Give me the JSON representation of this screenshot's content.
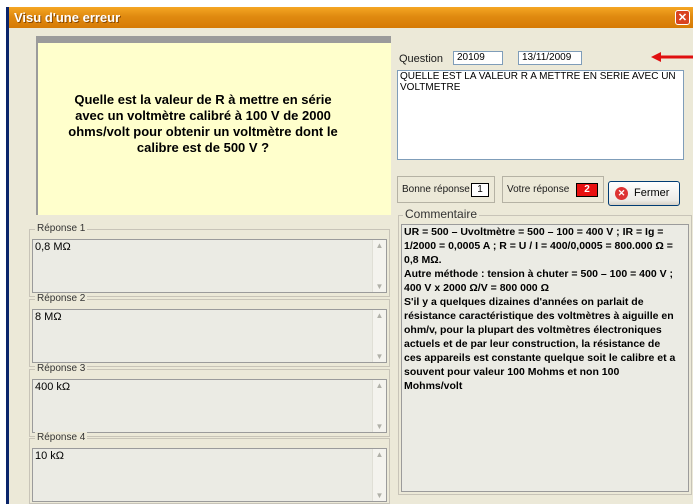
{
  "window": {
    "title": "Visu d'une erreur",
    "close_glyph": "✕"
  },
  "question_panel": {
    "text": "Quelle est la valeur de R à mettre en série avec un voltmètre calibré à 100 V de 2000 ohms/volt pour obtenir un voltmètre dont le calibre est de 500 V ?"
  },
  "answers": [
    {
      "legend": "Réponse 1",
      "value": "0,8 MΩ"
    },
    {
      "legend": "Réponse 2",
      "value": "8 MΩ"
    },
    {
      "legend": "Réponse 3",
      "value": "400 kΩ"
    },
    {
      "legend": "Réponse 4",
      "value": "10 kΩ"
    }
  ],
  "question": {
    "label": "Question",
    "number": "20109",
    "date": "13/11/2009",
    "text": "QUELLE EST LA VALEUR R A METTRE EN SERIE AVEC UN VOLTMETRE"
  },
  "bonne_reponse": {
    "label": "Bonne réponse",
    "value": "1"
  },
  "votre_reponse": {
    "label": "Votre réponse",
    "value": "2"
  },
  "fermer_button": {
    "label": "Fermer"
  },
  "commentaire": {
    "legend": "Commentaire",
    "text": "UR = 500 – Uvoltmètre = 500 – 100 = 400 V ; IR = Ig = 1/2000 = 0,0005 A ; R = U / I = 400/0,0005 = 800.000 Ω = 0,8 MΩ.\nAutre méthode : tension à chuter = 500 – 100 = 400 V ; 400 V x 2000 Ω/V = 800 000 Ω\nS'il y a quelques dizaines d'années on parlait de résistance caractéristique des voltmètres à aiguille en ohm/v, pour la plupart des voltmètres électroniques actuels et de par leur construction, la résistance de ces appareils est constante quelque soit le calibre et a souvent pour valeur 100 Mohms et non 100 Mohms/volt"
  },
  "colors": {
    "votre_reponse_bg": "#e81010",
    "question_bg": "#ffffcc",
    "arrow": "#e01010"
  }
}
